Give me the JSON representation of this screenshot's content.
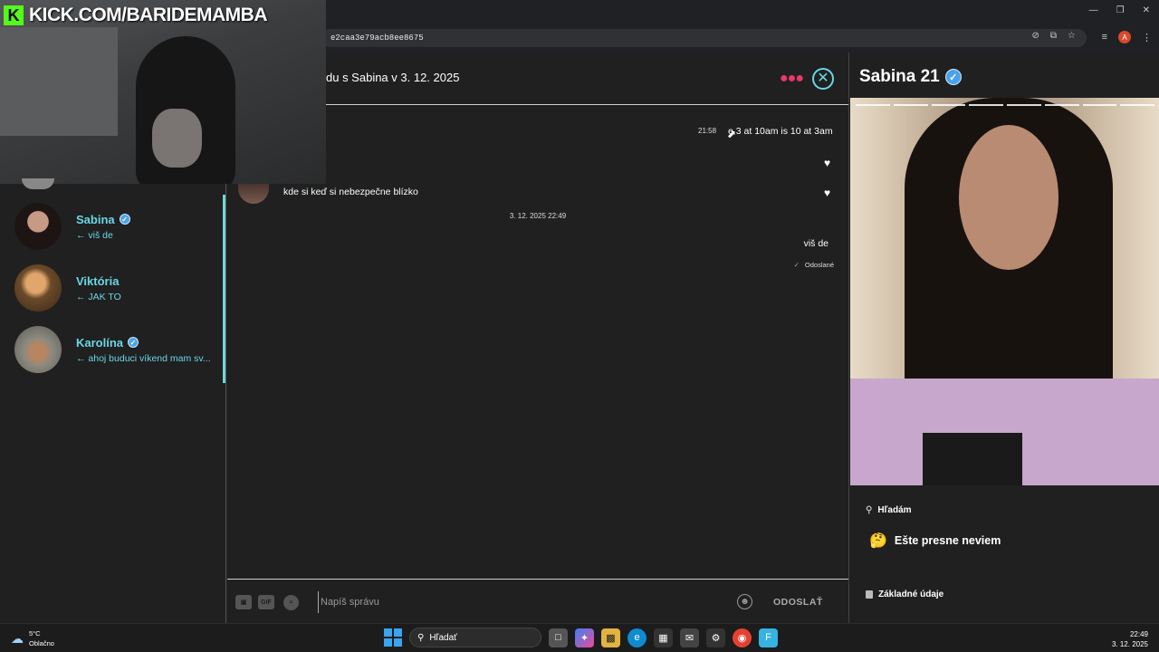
{
  "browser": {
    "url": "e2caa3e79acb8ee8675",
    "profile_initial": "A"
  },
  "stream": {
    "badge_text": "KICK.COM/BARIDEMAMBA",
    "logo_letter": "K"
  },
  "sidebar": {
    "conversations": [
      {
        "name": "Sabina",
        "preview": "← viš de",
        "verified": true
      },
      {
        "name": "Viktória",
        "preview": "← JAK TO",
        "verified": false
      },
      {
        "name": "Karolína",
        "preview": "← ahoj buduci víkend mam sv...",
        "verified": true
      }
    ]
  },
  "chat": {
    "title": "du s Sabina v 3. 12. 2025",
    "messages": {
      "time1": "21:58",
      "right1": "e 3 at 10am is 10 at 3am",
      "left1": "kde si keď si nebezpečne blízko",
      "date_separator": "3. 12. 2025 22:49",
      "right2": "viš de",
      "status": "Odoslané"
    },
    "input": {
      "placeholder": "Napíš správu",
      "gif_label": "GIF",
      "send_label": "ODOSLAŤ"
    }
  },
  "profile": {
    "name": "Sabina 21",
    "looking_for_heading": "Hľadám",
    "looking_for_value": "Ešte presne neviem",
    "looking_for_emoji": "🤔",
    "basic_info_heading": "Základné údaje"
  },
  "taskbar": {
    "weather_temp": "5°C",
    "weather_desc": "Oblačno",
    "search_label": "Hľadať",
    "time": "22:49",
    "date": "3. 12. 2025"
  },
  "colors": {
    "accent": "#6ad6e6",
    "dots": "#e8386a",
    "kick_green": "#53fc18"
  }
}
